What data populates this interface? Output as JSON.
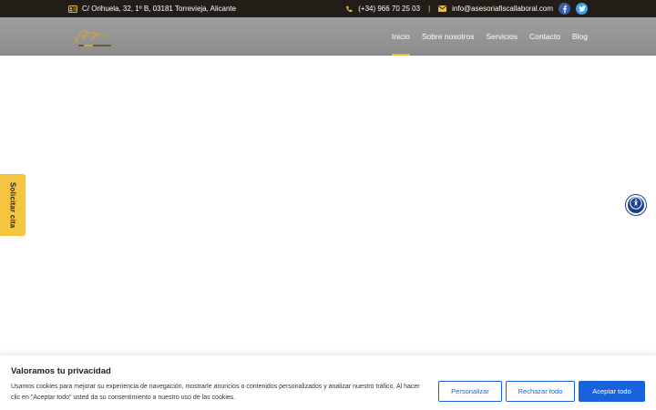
{
  "topbar": {
    "address": "C/ Orihuela, 32, 1º B, 03181 Torrevieja, Alicante",
    "phone": "(+34) 966 70 25 03",
    "separator": "|",
    "email": "info@asesoriafiscallaboral.com",
    "icons": [
      "address-card-icon",
      "phone-icon",
      "envelope-icon",
      "facebook-icon",
      "twitter-icon"
    ]
  },
  "nav": {
    "items": [
      {
        "label": "Inicio",
        "active": true
      },
      {
        "label": "Sobre nosotros",
        "active": false
      },
      {
        "label": "Servicios",
        "active": false
      },
      {
        "label": "Contacto",
        "active": false
      },
      {
        "label": "Blog",
        "active": false
      }
    ]
  },
  "side_tab": {
    "label": "Solicitar cita"
  },
  "cookie_banner": {
    "title": "Valoramos tu privacidad",
    "text": "Usamos cookies para mejorar su experiencia de navegación, mostrarle anuncios o contenidos personalizados y analizar nuestro tráfico. Al hacer clic en \"Aceptar todo\" usted da su consentimiento a nuestro uso de las cookies.",
    "buttons": {
      "customize": "Personalizar",
      "reject": "Rechazar todo",
      "accept": "Aceptar todo"
    }
  },
  "colors": {
    "topbar_bg": "#221d17",
    "accent_gold": "#f2b43c",
    "primary_blue": "#1863dc",
    "accessibility_blue": "#1d3f8a"
  }
}
